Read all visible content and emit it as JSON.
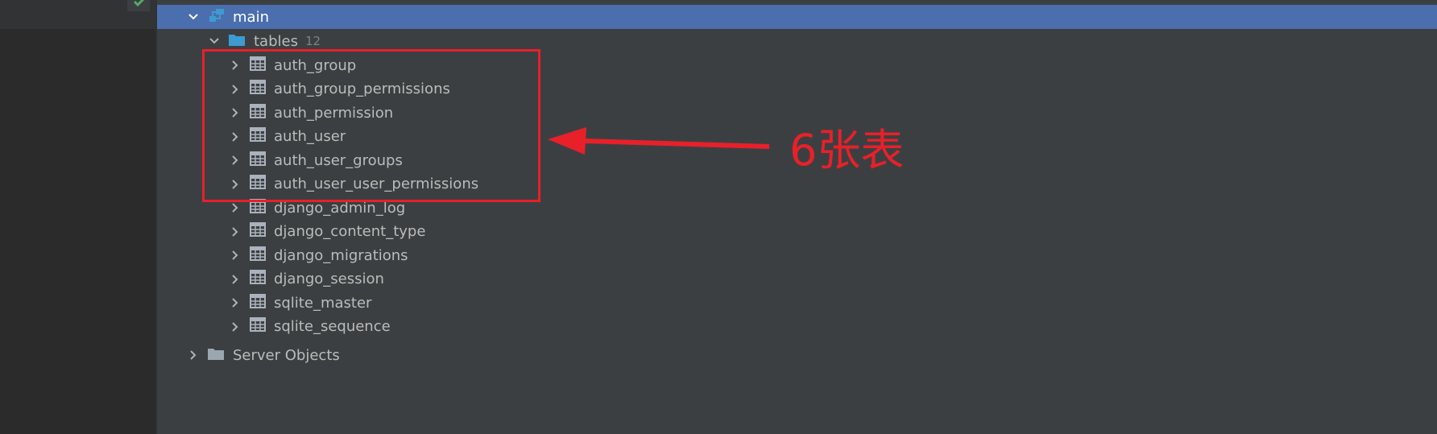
{
  "tree": {
    "main": {
      "label": "main"
    },
    "tables": {
      "label": "tables",
      "count": "12"
    },
    "table_items": [
      {
        "label": "auth_group"
      },
      {
        "label": "auth_group_permissions"
      },
      {
        "label": "auth_permission"
      },
      {
        "label": "auth_user"
      },
      {
        "label": "auth_user_groups"
      },
      {
        "label": "auth_user_user_permissions"
      },
      {
        "label": "django_admin_log"
      },
      {
        "label": "django_content_type"
      },
      {
        "label": "django_migrations"
      },
      {
        "label": "django_session"
      },
      {
        "label": "sqlite_master"
      },
      {
        "label": "sqlite_sequence"
      }
    ],
    "server_objects": {
      "label": "Server Objects"
    }
  },
  "annotation": {
    "text": "6张表",
    "color": "#e8202a"
  },
  "colors": {
    "background": "#3c3f41",
    "selection": "#4b6eaf",
    "folder": "#3d9bd1",
    "table_icon": "#aab2bd"
  },
  "icons": {
    "expanded": "chevron-down-icon",
    "collapsed": "chevron-right-icon",
    "schema": "schema-icon",
    "folder": "folder-icon",
    "table": "table-icon",
    "server": "folder-gray-icon"
  }
}
